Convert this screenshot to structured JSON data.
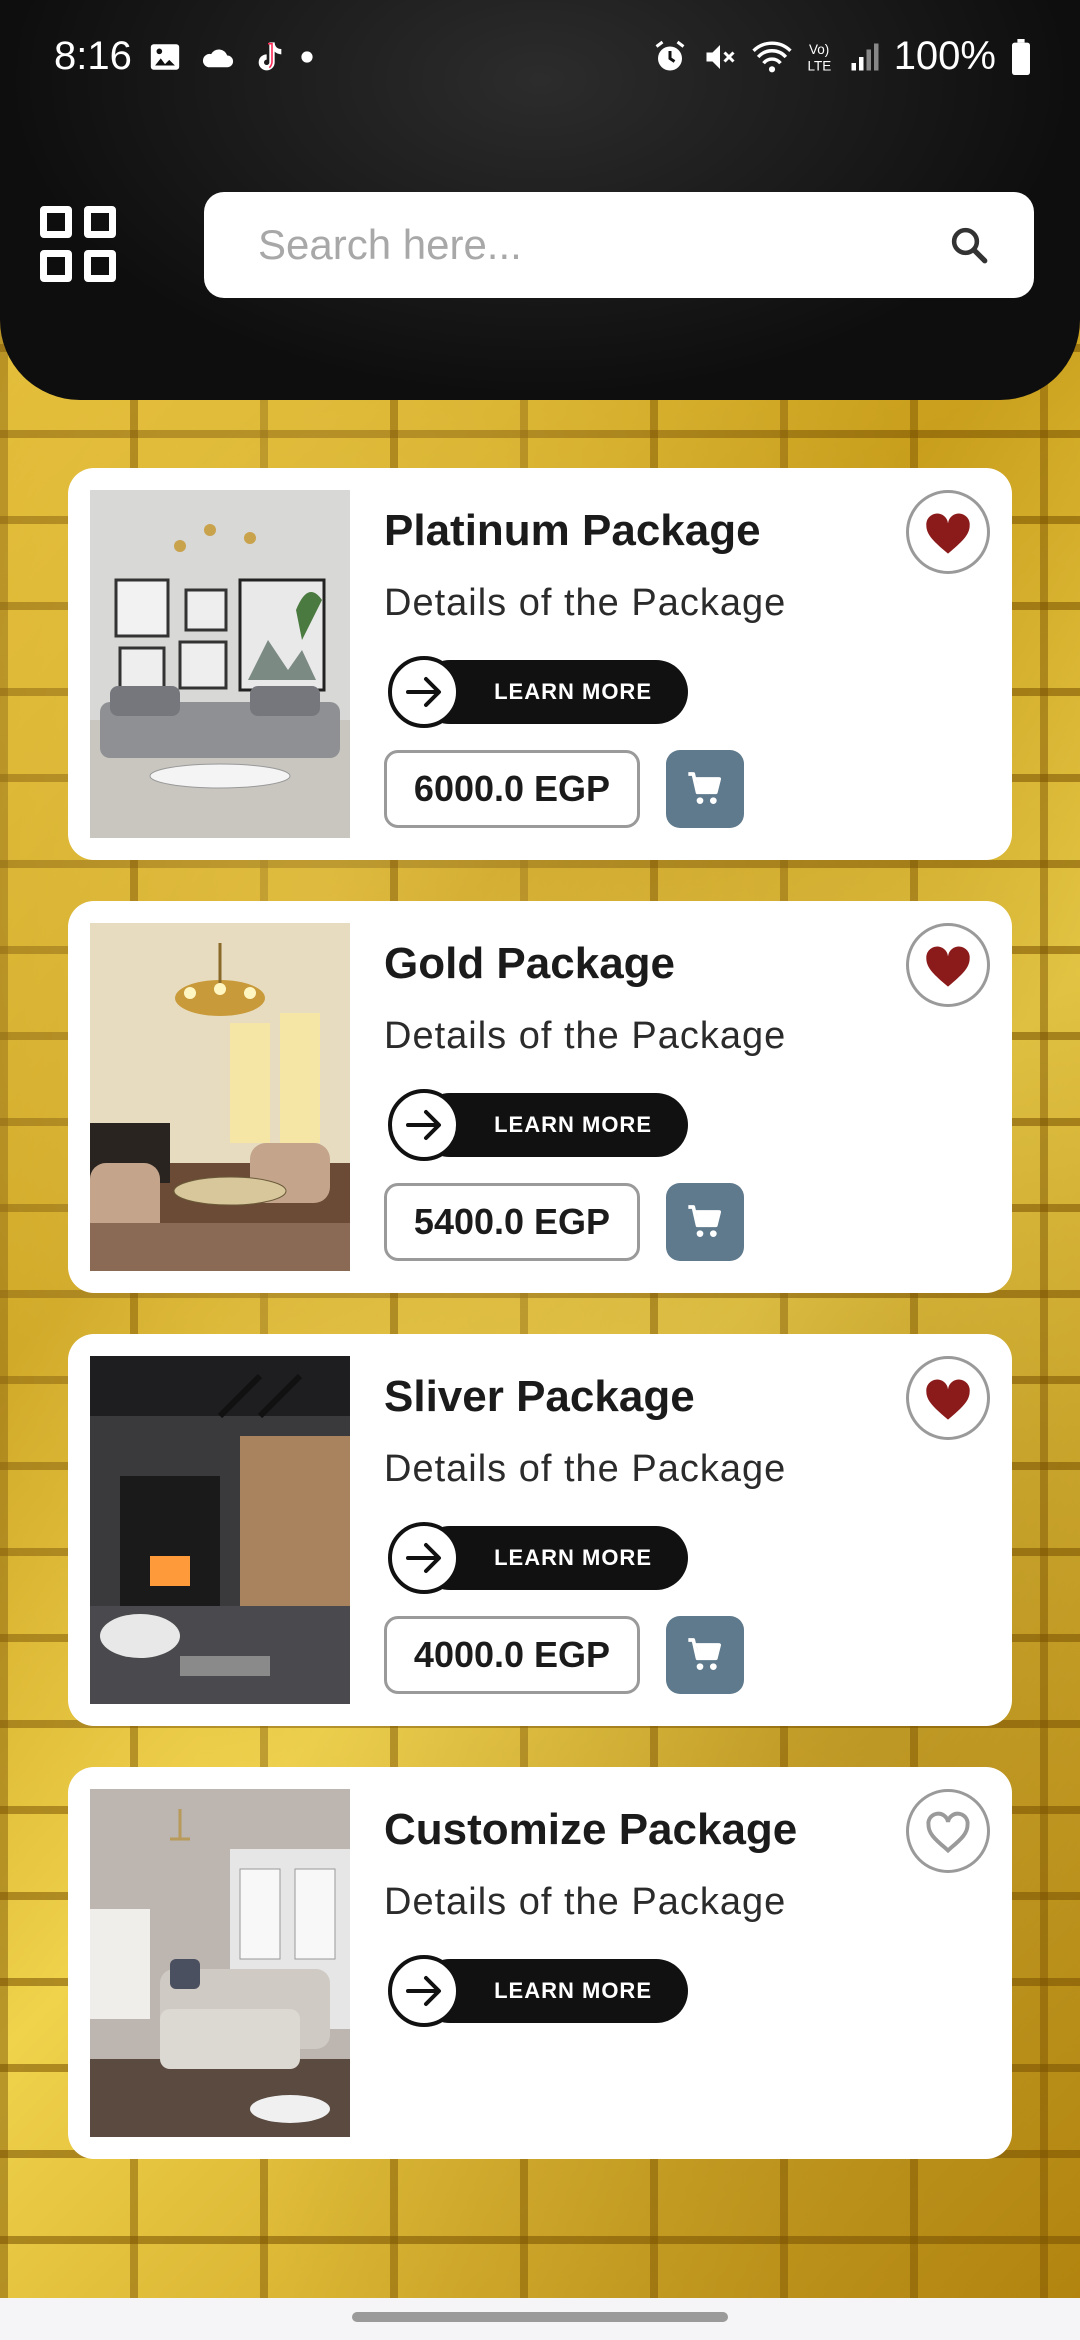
{
  "status_bar": {
    "time": "8:16",
    "battery": "100%",
    "icons": [
      "image-icon",
      "cloud-icon",
      "tiktok-icon",
      "dot-icon",
      "alarm-icon",
      "mute-icon",
      "wifi-icon",
      "volte-icon",
      "signal-icon",
      "battery-icon"
    ]
  },
  "header": {
    "menu_icon": "grid-icon",
    "search": {
      "placeholder": "Search here...",
      "value": "",
      "icon": "search-icon"
    }
  },
  "packages": [
    {
      "title": "Platinum Package",
      "details": "Details of the Package",
      "learn_more": "LEARN MORE",
      "price": "6000.0 EGP",
      "favorite": true,
      "has_price": true
    },
    {
      "title": "Gold Package",
      "details": "Details of the Package",
      "learn_more": "LEARN MORE",
      "price": "5400.0 EGP",
      "favorite": true,
      "has_price": true
    },
    {
      "title": "Sliver Package",
      "details": "Details of the Package",
      "learn_more": "LEARN MORE",
      "price": "4000.0 EGP",
      "favorite": true,
      "has_price": true
    },
    {
      "title": "Customize Package",
      "details": "Details of the Package",
      "learn_more": "LEARN MORE",
      "favorite": false,
      "has_price": false
    }
  ],
  "colors": {
    "header_bg": "#111111",
    "favorite_active": "#8b1a1a",
    "cart_button": "#5f7a8d",
    "background_gold": "#d9b02a"
  }
}
